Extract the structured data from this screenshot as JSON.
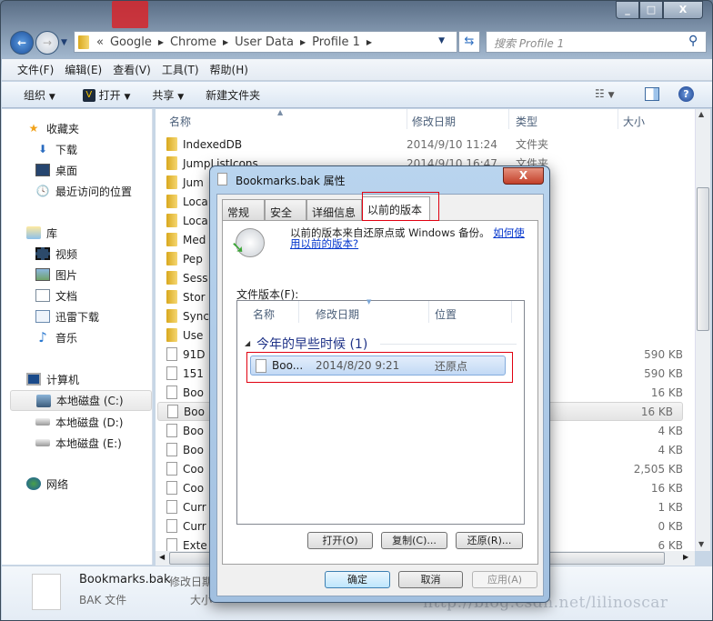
{
  "window": {
    "controls": [
      "minimize",
      "maximize",
      "close"
    ],
    "close_label": "X"
  },
  "address": {
    "overflow": "«",
    "crumbs": [
      "Google",
      "Chrome",
      "User Data",
      "Profile 1"
    ]
  },
  "search": {
    "placeholder": "搜索 Profile 1"
  },
  "menu": [
    "文件(F)",
    "编辑(E)",
    "查看(V)",
    "工具(T)",
    "帮助(H)"
  ],
  "toolbar": {
    "organize": "组织",
    "open": "打开",
    "share": "共享",
    "new_folder": "新建文件夹"
  },
  "sidebar": {
    "favorites": {
      "label": "收藏夹",
      "items": [
        "下载",
        "桌面",
        "最近访问的位置"
      ]
    },
    "libraries": {
      "label": "库",
      "items": [
        "视频",
        "图片",
        "文档",
        "迅雷下载",
        "音乐"
      ]
    },
    "computer": {
      "label": "计算机",
      "items": [
        "本地磁盘 (C:)",
        "本地磁盘 (D:)",
        "本地磁盘 (E:)"
      ],
      "selected": 0
    },
    "network": {
      "label": "网络"
    }
  },
  "columns": {
    "name": "名称",
    "date": "修改日期",
    "type": "类型",
    "size": "大小"
  },
  "files": [
    {
      "name": "IndexedDB",
      "date": "2014/9/10 11:24",
      "type": "文件夹",
      "size": "",
      "kind": "folder"
    },
    {
      "name": "JumpListIcons",
      "date": "2014/9/10 16:47",
      "type": "文件夹",
      "size": "",
      "kind": "folder"
    },
    {
      "name": "Jum",
      "date": "",
      "type": "",
      "size": "",
      "kind": "folder"
    },
    {
      "name": "Loca",
      "date": "",
      "type": "",
      "size": "",
      "kind": "folder"
    },
    {
      "name": "Loca",
      "date": "",
      "type": "",
      "size": "",
      "kind": "folder"
    },
    {
      "name": "Med",
      "date": "",
      "type": "",
      "size": "",
      "kind": "folder"
    },
    {
      "name": "Pep",
      "date": "",
      "type": "",
      "size": "",
      "kind": "folder"
    },
    {
      "name": "Sess",
      "date": "",
      "type": "",
      "size": "",
      "kind": "folder"
    },
    {
      "name": "Stor",
      "date": "",
      "type": "",
      "size": "",
      "kind": "folder"
    },
    {
      "name": "Sync",
      "date": "",
      "type": "",
      "size": "",
      "kind": "folder"
    },
    {
      "name": "Use",
      "date": "",
      "type": "",
      "size": "",
      "kind": "folder"
    },
    {
      "name": "91D",
      "date": "",
      "type": "件",
      "size": "590 KB",
      "kind": "file"
    },
    {
      "name": "151",
      "date": "",
      "type": "件",
      "size": "590 KB",
      "kind": "file"
    },
    {
      "name": "Boo",
      "date": "",
      "type": "",
      "size": "16 KB",
      "kind": "file"
    },
    {
      "name": "Boo",
      "date": "",
      "type": "件",
      "size": "16 KB",
      "kind": "file",
      "selected": true
    },
    {
      "name": "Boo",
      "date": "",
      "type": "",
      "size": "4 KB",
      "kind": "file"
    },
    {
      "name": "Boo",
      "date": "",
      "type": "件",
      "size": "4 KB",
      "kind": "file"
    },
    {
      "name": "Coo",
      "date": "",
      "type": "",
      "size": "2,505 KB",
      "kind": "file"
    },
    {
      "name": "Coo",
      "date": "",
      "type": "",
      "size": "16 KB",
      "kind": "file"
    },
    {
      "name": "Curr",
      "date": "",
      "type": "",
      "size": "1 KB",
      "kind": "file"
    },
    {
      "name": "Curr",
      "date": "",
      "type": "",
      "size": "0 KB",
      "kind": "file"
    },
    {
      "name": "Exte",
      "date": "",
      "type": "",
      "size": "6 KB",
      "kind": "file"
    }
  ],
  "details": {
    "name": "Bookmarks.bak",
    "type": "BAK 文件",
    "date_label": "修改日期",
    "size_label": "大小"
  },
  "dialog": {
    "title": "Bookmarks.bak 属性",
    "close": "X",
    "tabs": [
      "常规",
      "安全",
      "详细信息",
      "以前的版本"
    ],
    "active_tab": 3,
    "info": "以前的版本来自还原点或 Windows 备份。",
    "link": "如何使用以前的版本?",
    "list_label": "文件版本(F):",
    "list_columns": [
      "名称",
      "修改日期",
      "位置"
    ],
    "group": "今年的早些时候 (1)",
    "versions": [
      {
        "name": "Boo...",
        "date": "2014/8/20 9:21",
        "location": "还原点"
      }
    ],
    "buttons": {
      "open": "打开(O)",
      "copy": "复制(C)...",
      "restore": "还原(R)..."
    },
    "footer": {
      "ok": "确定",
      "cancel": "取消",
      "apply": "应用(A)"
    }
  },
  "watermark": "http://blog.csdn.net/lilinoscar",
  "colors": {
    "highlight": "#e00010",
    "link": "#0033cc",
    "group": "#1e3287"
  }
}
